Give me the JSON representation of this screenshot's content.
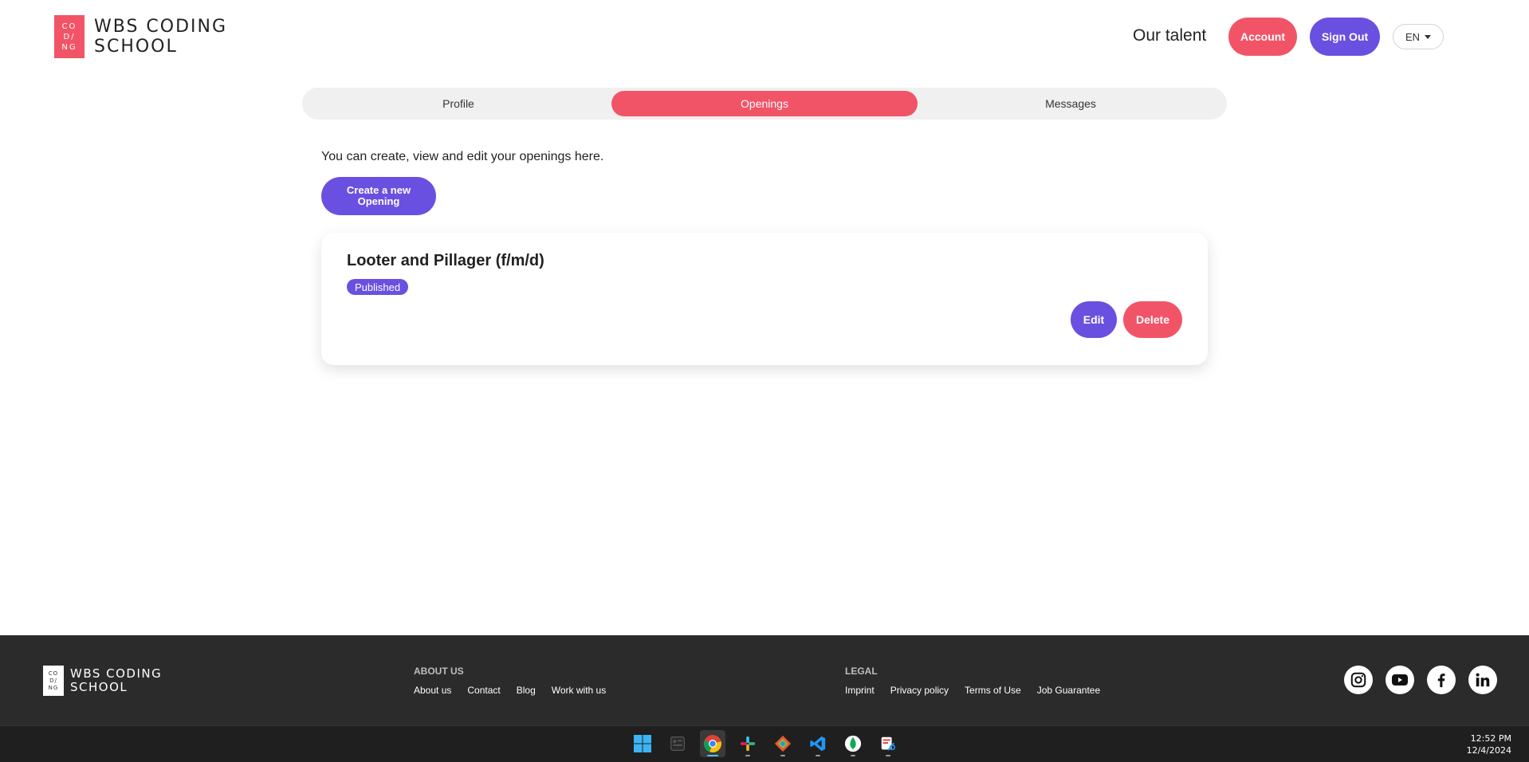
{
  "header": {
    "logo_mark": [
      "CO",
      "D/",
      "NG"
    ],
    "logo_line1": "WBS CODING",
    "logo_line2": "SCHOOL",
    "nav_talent": "Our talent",
    "account_label": "Account",
    "signout_label": "Sign Out",
    "language": "EN"
  },
  "tabs": [
    {
      "label": "Profile",
      "active": false
    },
    {
      "label": "Openings",
      "active": true
    },
    {
      "label": "Messages",
      "active": false
    }
  ],
  "main": {
    "intro": "You can create, view and edit your openings here.",
    "create_label_line1": "Create a new",
    "create_label_line2": "Opening",
    "openings": [
      {
        "title": "Looter and Pillager (f/m/d)",
        "status": "Published",
        "edit_label": "Edit",
        "delete_label": "Delete"
      }
    ]
  },
  "footer": {
    "logo_line1": "WBS CODING",
    "logo_line2": "SCHOOL",
    "about_heading": "ABOUT US",
    "about_links": [
      "About us",
      "Contact",
      "Blog",
      "Work with us"
    ],
    "legal_heading": "LEGAL",
    "legal_links": [
      "Imprint",
      "Privacy policy",
      "Terms of Use",
      "Job Guarantee"
    ],
    "social_icons": [
      "instagram-icon",
      "youtube-icon",
      "facebook-icon",
      "linkedin-icon"
    ]
  },
  "taskbar": {
    "apps": [
      "windows-start-icon",
      "task-view-icon",
      "chrome-icon",
      "slack-icon",
      "git-icon",
      "vscode-icon",
      "mongodb-icon",
      "snipping-tool-icon"
    ],
    "time": "12:52 PM",
    "date": "12/4/2024"
  },
  "colors": {
    "accent_pink": "#f25467",
    "accent_purple": "#6a50e0",
    "footer_bg": "#2b2b2b"
  }
}
